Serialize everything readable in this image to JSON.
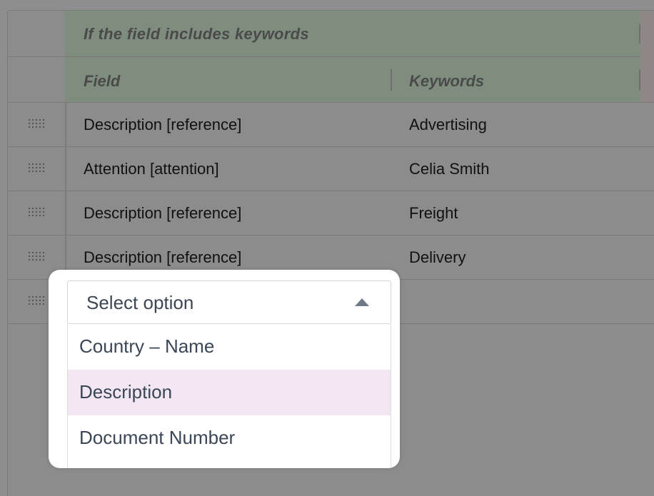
{
  "table": {
    "group_header": "If the field includes keywords",
    "columns": [
      "Field",
      "Keywords"
    ],
    "rows": [
      {
        "field": "Description [reference]",
        "keywords": "Advertising"
      },
      {
        "field": "Attention [attention]",
        "keywords": "Celia Smith"
      },
      {
        "field": "Description [reference]",
        "keywords": "Freight"
      },
      {
        "field": "Description [reference]",
        "keywords": "Delivery"
      }
    ]
  },
  "dropdown": {
    "placeholder": "Select option",
    "options": [
      "Country – Name",
      "Description",
      "Document Number"
    ],
    "highlighted_index": 1,
    "highlight_color": "#f2e6f3"
  },
  "icons": {
    "row_handle": "grip-icon",
    "caret": "caret-up-icon"
  }
}
